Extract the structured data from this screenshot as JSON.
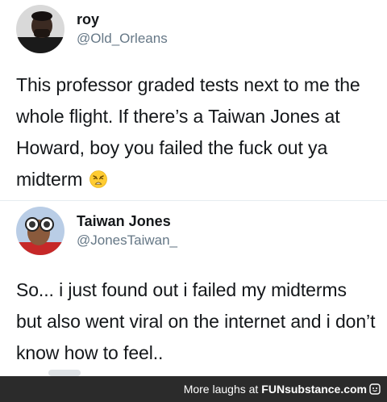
{
  "tweet_1": {
    "display_name": "roy",
    "handle": "@Old_Orleans",
    "text": "This professor graded tests next to me the whole flight. If there’s a Taiwan Jones at Howard, boy you failed the fuck out ya midterm",
    "emoji": "weary-face-emoji"
  },
  "tweet_2": {
    "display_name": "Taiwan Jones",
    "handle": "@JonesTaiwan_",
    "text": "So... i just found out i failed my midterms but also went viral on the internet and i don’t know how to feel.."
  },
  "footer": {
    "prefix": "More laughs at",
    "brand": "FUNsubstance.com"
  },
  "colors": {
    "text": "#14171a",
    "handle": "#657786",
    "footer_bg": "#2b2b2b",
    "footer_text": "#ffffff"
  }
}
